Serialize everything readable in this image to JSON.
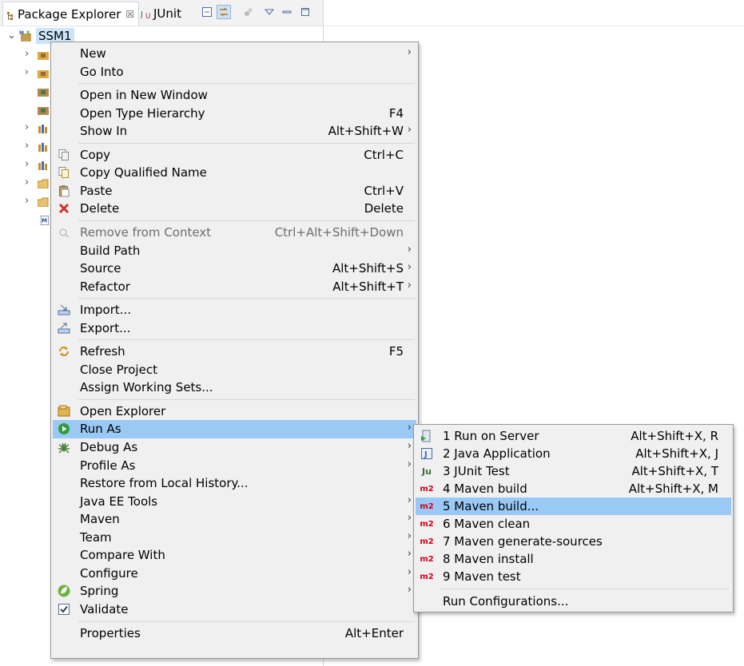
{
  "explorer": {
    "tabs": [
      {
        "label": "Package Explorer",
        "close": "☒"
      },
      {
        "label": "JUnit"
      }
    ],
    "project": "SSM1"
  },
  "context_menu": {
    "items": [
      {
        "label": "New",
        "submenu": true
      },
      {
        "label": "Go Into"
      },
      {
        "separator": true
      },
      {
        "label": "Open in New Window"
      },
      {
        "label": "Open Type Hierarchy",
        "shortcut": "F4"
      },
      {
        "label": "Show In",
        "shortcut": "Alt+Shift+W",
        "submenu": true
      },
      {
        "separator": true
      },
      {
        "label": "Copy",
        "shortcut": "Ctrl+C",
        "icon": "copy-icon"
      },
      {
        "label": "Copy Qualified Name",
        "icon": "copy-qualified-icon"
      },
      {
        "label": "Paste",
        "shortcut": "Ctrl+V",
        "icon": "paste-icon"
      },
      {
        "label": "Delete",
        "shortcut": "Delete",
        "icon": "delete-icon"
      },
      {
        "separator": true
      },
      {
        "label": "Remove from Context",
        "shortcut": "Ctrl+Alt+Shift+Down",
        "disabled": true,
        "icon": "remove-context-icon"
      },
      {
        "label": "Build Path",
        "submenu": true
      },
      {
        "label": "Source",
        "shortcut": "Alt+Shift+S",
        "submenu": true
      },
      {
        "label": "Refactor",
        "shortcut": "Alt+Shift+T",
        "submenu": true
      },
      {
        "separator": true
      },
      {
        "label": "Import...",
        "icon": "import-icon"
      },
      {
        "label": "Export...",
        "icon": "export-icon"
      },
      {
        "separator": true
      },
      {
        "label": "Refresh",
        "shortcut": "F5",
        "icon": "refresh-icon"
      },
      {
        "label": "Close Project"
      },
      {
        "label": "Assign Working Sets..."
      },
      {
        "separator": true
      },
      {
        "label": "Open Explorer",
        "icon": "open-explorer-icon"
      },
      {
        "label": "Run As",
        "submenu": true,
        "highlighted": true,
        "icon": "run-icon"
      },
      {
        "label": "Debug As",
        "submenu": true,
        "icon": "debug-icon"
      },
      {
        "label": "Profile As",
        "submenu": true
      },
      {
        "label": "Restore from Local History..."
      },
      {
        "label": "Java EE Tools",
        "submenu": true
      },
      {
        "label": "Maven",
        "submenu": true
      },
      {
        "label": "Team",
        "submenu": true
      },
      {
        "label": "Compare With",
        "submenu": true
      },
      {
        "label": "Configure",
        "submenu": true
      },
      {
        "label": "Spring",
        "submenu": true,
        "icon": "spring-icon"
      },
      {
        "label": "Validate",
        "icon": "validate-checkbox-icon"
      },
      {
        "separator": true
      },
      {
        "label": "Properties",
        "shortcut": "Alt+Enter"
      }
    ]
  },
  "run_as_menu": {
    "items": [
      {
        "label": "1 Run on Server",
        "shortcut": "Alt+Shift+X, R",
        "icon": "server-run-icon"
      },
      {
        "label": "2 Java Application",
        "shortcut": "Alt+Shift+X, J",
        "icon": "java-app-icon"
      },
      {
        "label": "3 JUnit Test",
        "shortcut": "Alt+Shift+X, T",
        "icon": "junit-icon"
      },
      {
        "label": "4 Maven build",
        "shortcut": "Alt+Shift+X, M",
        "icon": "maven-icon"
      },
      {
        "label": "5 Maven build...",
        "highlighted": true,
        "icon": "maven-icon"
      },
      {
        "label": "6 Maven clean",
        "icon": "maven-icon"
      },
      {
        "label": "7 Maven generate-sources",
        "icon": "maven-icon"
      },
      {
        "label": "8 Maven install",
        "icon": "maven-icon"
      },
      {
        "label": "9 Maven test",
        "icon": "maven-icon"
      },
      {
        "separator": true
      },
      {
        "label": "Run Configurations..."
      }
    ]
  },
  "icons": {
    "maven_text": "m2",
    "junit_text": "Ju"
  },
  "colors": {
    "highlight": "#99c9f4",
    "menu_bg": "#f0f0f0",
    "disabled": "#6d6d6d"
  }
}
